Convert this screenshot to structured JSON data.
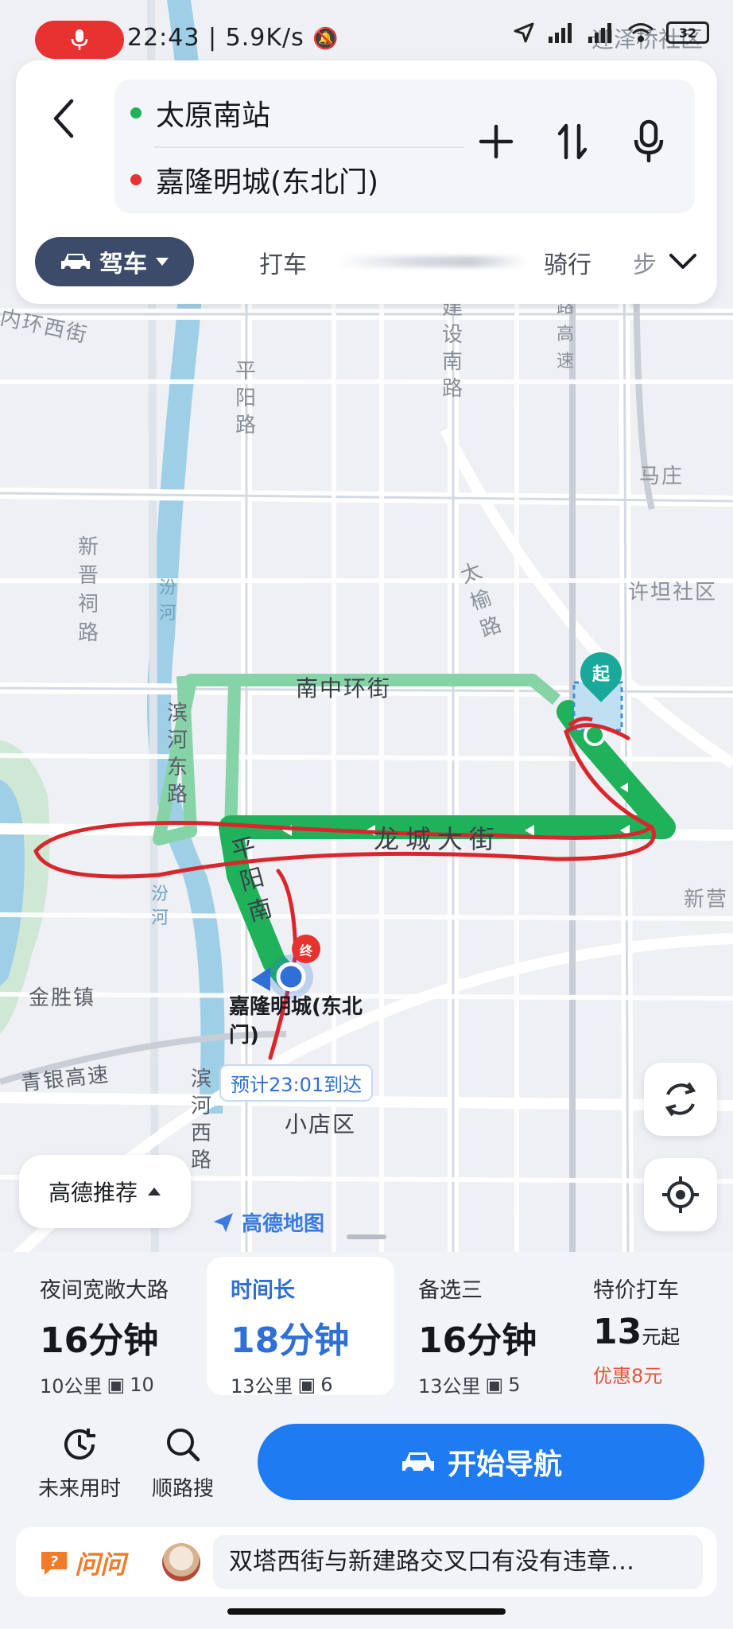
{
  "status": {
    "time": "22:43",
    "speed": "5.9K/s",
    "battery": "32",
    "overlay_text": "迎泽桥社区"
  },
  "search": {
    "start": "太原南站",
    "end": "嘉隆明城(东北门)"
  },
  "modes": {
    "drive": "驾车",
    "taxi": "打车",
    "ride": "骑行",
    "walk": "步"
  },
  "map": {
    "labels": {
      "inner_ring": "内环西街",
      "pingyang_road": "平阳路",
      "jianshe_south": "建设南路",
      "gaosu": "路 高速",
      "mazhuang": "马庄",
      "xinjin": "新晋祠路",
      "fen_river": "汾河",
      "taiyu": "太榆路",
      "xutan": "许坦社区",
      "nanzhong": "南中环街",
      "binhe_east": "滨河东路",
      "longcheng": "龙城大街",
      "pingyang_south": "平阳南",
      "fen_river_2": "汾河",
      "xinying": "新营",
      "jinsheng": "金胜镇",
      "qingyin": "青银高速",
      "binhe_west": "滨河西路",
      "xiaodian": "小店区"
    },
    "start_marker": "起",
    "end_marker": "终",
    "dest_label": "嘉隆明城(东北门)",
    "eta": "预计23:01到达",
    "recommend": "高德推荐",
    "logo": "高德地图",
    "route_color": "#1fb25a",
    "alt_route_color": "#86d3a7",
    "annotation_color": "#d8262c"
  },
  "plans": [
    {
      "name": "夜间宽敞大路",
      "time": "16分钟",
      "distance": "10公里",
      "lights": "10"
    },
    {
      "name": "时间长",
      "time": "18分钟",
      "distance": "13公里",
      "lights": "6"
    },
    {
      "name": "备选三",
      "time": "16分钟",
      "distance": "13公里",
      "lights": "5"
    },
    {
      "name": "特价打车",
      "price": "13",
      "price_unit": "元起",
      "promo": "优惠8元"
    }
  ],
  "actions": {
    "future": "未来用时",
    "along": "顺路搜",
    "start_nav": "开始导航"
  },
  "ask": {
    "brand": "问问",
    "question": "双塔西街与新建路交叉口有没有违章…"
  }
}
